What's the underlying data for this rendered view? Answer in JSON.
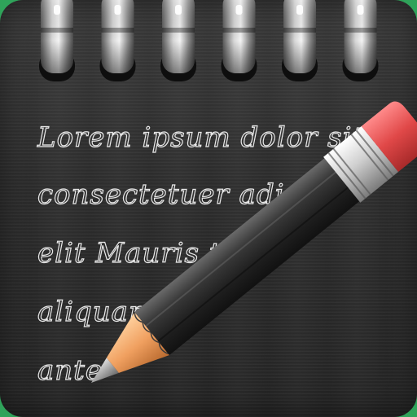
{
  "app_icon": {
    "name": "notepad-app-icon",
    "colors": {
      "background_green": "#2fa35a",
      "pad_dark": "#2e2e2e",
      "ring_metal": "#9a9a9a",
      "handwriting": "#e8e8e8",
      "pencil_body": "#2a2a2a",
      "pencil_wood": "#f0a060",
      "pencil_eraser": "#e25555",
      "pencil_ferrule": "#d8d8d8"
    },
    "spiral_ring_count": 6
  },
  "handwriting": {
    "lines": [
      "Lorem ipsum dolor sit amet",
      "consectetuer adipis",
      "elit Mauris t",
      "aliquam",
      "ante"
    ]
  },
  "icons": {
    "pencil": "pencil-icon",
    "spiral": "spiral-binding-icon"
  }
}
